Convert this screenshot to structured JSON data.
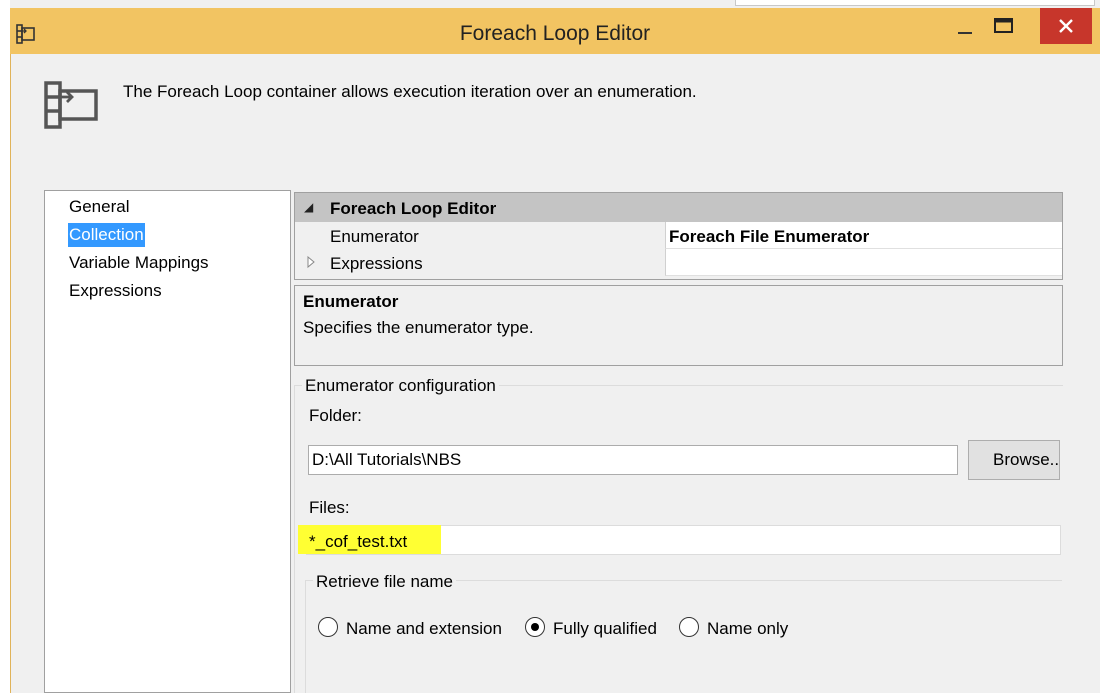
{
  "window": {
    "title": "Foreach Loop Editor",
    "header_description": "The Foreach Loop container allows execution iteration over an enumeration."
  },
  "nav": {
    "items": [
      {
        "label": "General"
      },
      {
        "label": "Collection",
        "selected": true
      },
      {
        "label": "Variable Mappings"
      },
      {
        "label": "Expressions"
      }
    ]
  },
  "property_grid": {
    "category": "Foreach Loop Editor",
    "rows": [
      {
        "name": "Enumerator",
        "value": "Foreach File Enumerator"
      },
      {
        "name": "Expressions",
        "value": ""
      }
    ]
  },
  "help": {
    "title": "Enumerator",
    "text": "Specifies the enumerator type."
  },
  "enumerator_config": {
    "legend": "Enumerator configuration",
    "folder_label": "Folder:",
    "folder_value": "D:\\All Tutorials\\NBS",
    "browse_label": "Browse...",
    "files_label": "Files:",
    "files_value": "*_cof_test.txt",
    "retrieve": {
      "legend": "Retrieve file name",
      "options": [
        {
          "label": "Name and extension",
          "checked": false
        },
        {
          "label": "Fully qualified",
          "checked": true
        },
        {
          "label": "Name only",
          "checked": false
        }
      ]
    }
  },
  "colors": {
    "titlebar": "#f2c462",
    "close_button": "#c7362b",
    "selection": "#3399ff",
    "highlight": "#ffff33"
  }
}
